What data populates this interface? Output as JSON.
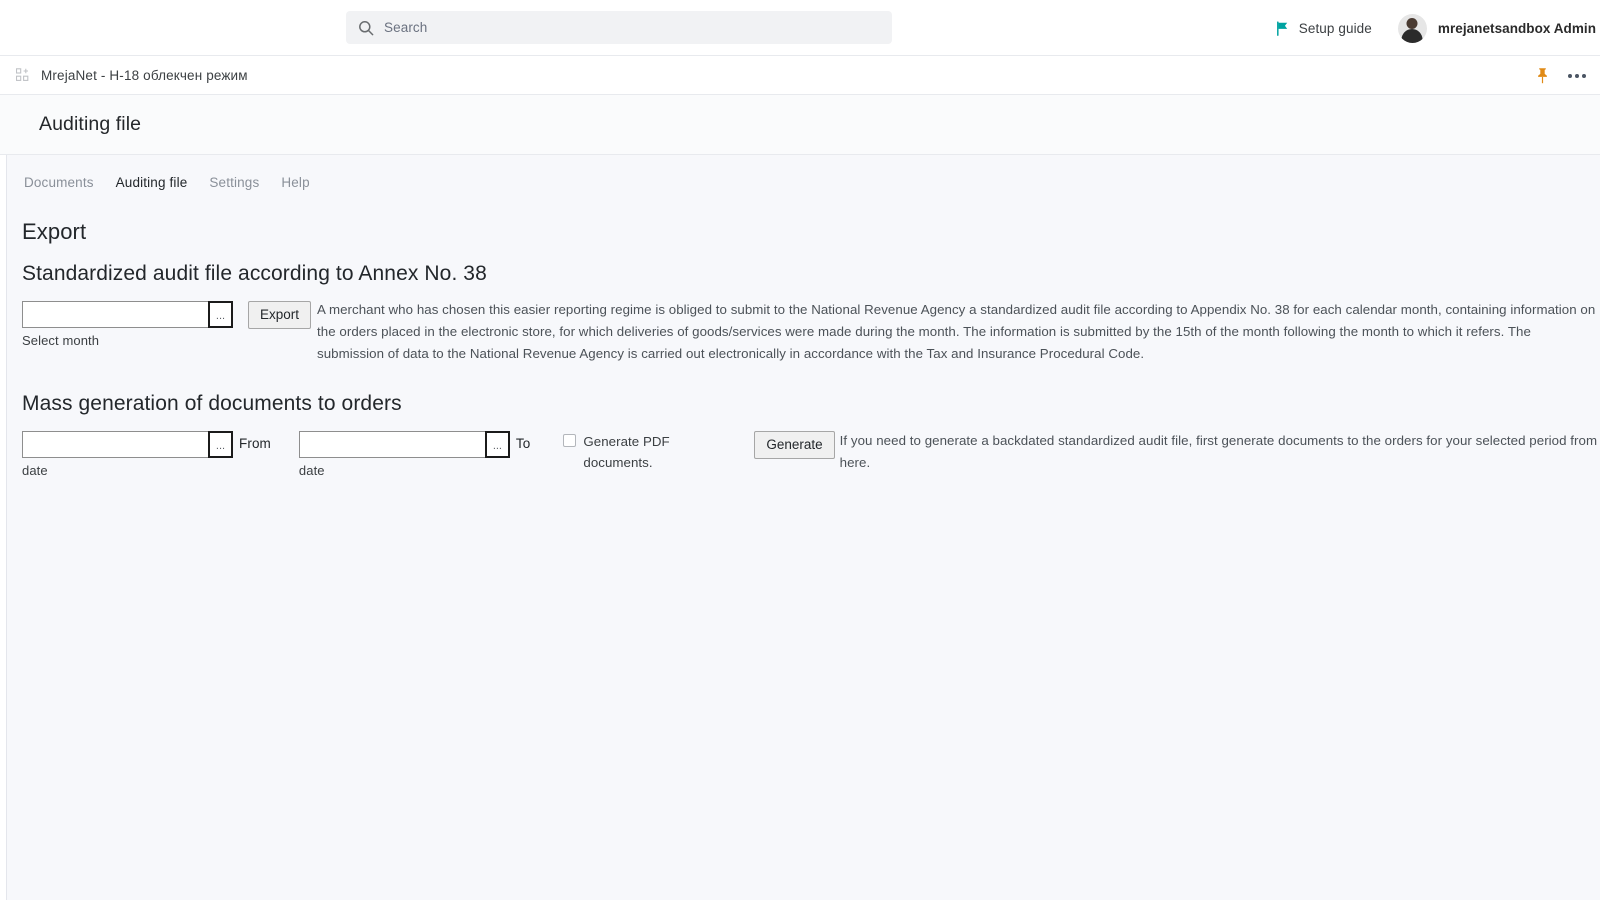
{
  "header": {
    "search": {
      "placeholder": "Search",
      "value": "",
      "icon": "search-icon"
    },
    "setup_guide": {
      "label": "Setup guide",
      "icon": "flag-icon",
      "color": "#00a3a1"
    },
    "user": {
      "name": "mrejanetsandbox Admin",
      "avatar": "user-avatar"
    }
  },
  "breadcrumb": {
    "icon": "apps-grid-icon",
    "label": "MrejaNet - Н-18 облекчен режим",
    "pin": {
      "icon": "pin-icon",
      "color": "#e08a16"
    },
    "more": {
      "icon": "ellipsis-icon"
    }
  },
  "page": {
    "title": "Auditing file"
  },
  "nav": {
    "tabs": [
      {
        "label": "Documents",
        "active": false
      },
      {
        "label": "Auditing file",
        "active": true
      },
      {
        "label": "Settings",
        "active": false
      },
      {
        "label": "Help",
        "active": false
      }
    ]
  },
  "main": {
    "export_heading": "Export",
    "section1": {
      "heading": "Standardized audit file according to Annex No. 38",
      "month_field": {
        "value": "",
        "picker_label": "...",
        "sublabel": "Select month"
      },
      "export_button": "Export",
      "description": "A merchant who has chosen this easier reporting regime is obliged to submit to the National Revenue Agency a standardized audit file according to Appendix No. 38 for each calendar month, containing information on the orders placed in the electronic store, for which deliveries of goods/services were made during the month. The information is submitted by the 15th of the month following the month to which it refers. The submission of data to the National Revenue Agency is carried out electronically in accordance with the Tax and Insurance Procedural Code."
    },
    "section2": {
      "heading": "Mass generation of documents to orders",
      "from_field": {
        "value": "",
        "picker_label": "...",
        "side_label": "From",
        "sublabel": "date"
      },
      "to_field": {
        "value": "",
        "picker_label": "...",
        "side_label": "To",
        "sublabel": "date"
      },
      "pdf_checkbox": {
        "label": "Generate PDF documents.",
        "checked": false
      },
      "generate_button": "Generate",
      "description": "If you need to generate a backdated standardized audit file, first generate documents to the orders for your selected period from here."
    }
  }
}
